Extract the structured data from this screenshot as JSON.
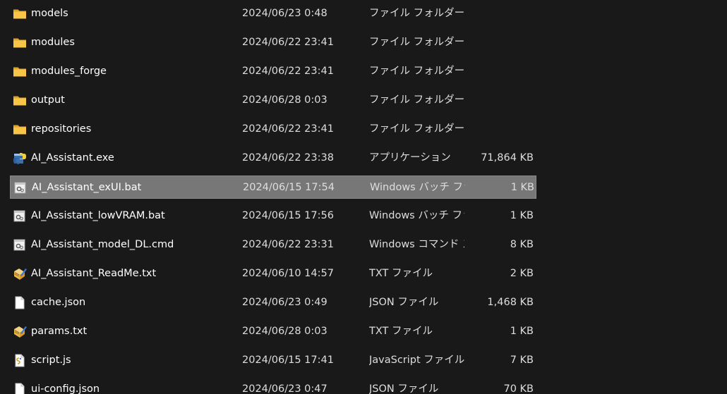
{
  "files": [
    {
      "name": "models",
      "modified": "2024/06/23 0:48",
      "type": "ファイル フォルダー",
      "size": "",
      "icon": "folder-icon"
    },
    {
      "name": "modules",
      "modified": "2024/06/22 23:41",
      "type": "ファイル フォルダー",
      "size": "",
      "icon": "folder-icon"
    },
    {
      "name": "modules_forge",
      "modified": "2024/06/22 23:41",
      "type": "ファイル フォルダー",
      "size": "",
      "icon": "folder-icon"
    },
    {
      "name": "output",
      "modified": "2024/06/28 0:03",
      "type": "ファイル フォルダー",
      "size": "",
      "icon": "folder-icon"
    },
    {
      "name": "repositories",
      "modified": "2024/06/22 23:41",
      "type": "ファイル フォルダー",
      "size": "",
      "icon": "folder-icon"
    },
    {
      "name": "AI_Assistant.exe",
      "modified": "2024/06/22 23:38",
      "type": "アプリケーション",
      "size": "71,864 KB",
      "icon": "python-exe-icon"
    },
    {
      "name": "AI_Assistant_exUI.bat",
      "modified": "2024/06/15 17:54",
      "type": "Windows バッチ ファ...",
      "size": "1 KB",
      "icon": "batch-file-icon",
      "selected": true
    },
    {
      "name": "AI_Assistant_lowVRAM.bat",
      "modified": "2024/06/15 17:56",
      "type": "Windows バッチ ファ...",
      "size": "1 KB",
      "icon": "batch-file-icon"
    },
    {
      "name": "AI_Assistant_model_DL.cmd",
      "modified": "2024/06/22 23:31",
      "type": "Windows コマンド ス...",
      "size": "8 KB",
      "icon": "batch-file-icon"
    },
    {
      "name": "AI_Assistant_ReadMe.txt",
      "modified": "2024/06/10 14:57",
      "type": "TXT ファイル",
      "size": "2 KB",
      "icon": "notepad-icon"
    },
    {
      "name": "cache.json",
      "modified": "2024/06/23 0:49",
      "type": "JSON ファイル",
      "size": "1,468 KB",
      "icon": "blank-file-icon"
    },
    {
      "name": "params.txt",
      "modified": "2024/06/28 0:03",
      "type": "TXT ファイル",
      "size": "1 KB",
      "icon": "notepad-icon"
    },
    {
      "name": "script.js",
      "modified": "2024/06/15 17:41",
      "type": "JavaScript ファイル",
      "size": "7 KB",
      "icon": "script-file-icon"
    },
    {
      "name": "ui-config.json",
      "modified": "2024/06/23 0:47",
      "type": "JSON ファイル",
      "size": "70 KB",
      "icon": "blank-file-icon"
    }
  ],
  "colors": {
    "background": "#191919",
    "selected_row": "#777777",
    "folder": "#f4c145",
    "text": "#ffffff"
  }
}
